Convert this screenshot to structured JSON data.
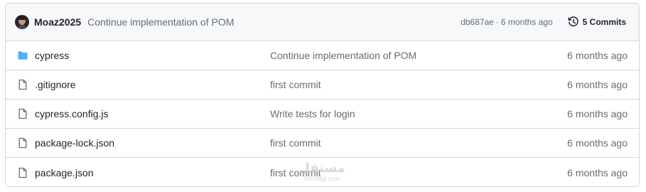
{
  "latest_commit": {
    "author": "Moaz2025",
    "message": "Continue implementation of POM",
    "sha": "db687ae",
    "separator": "·",
    "time": "6 months ago",
    "commits_label": "5 Commits"
  },
  "files": [
    {
      "name": "cypress",
      "type": "folder",
      "icon": "folder-icon",
      "message": "Continue implementation of POM",
      "age": "6 months ago"
    },
    {
      "name": ".gitignore",
      "type": "file",
      "icon": "file-icon",
      "message": "first commit",
      "age": "6 months ago"
    },
    {
      "name": "cypress.config.js",
      "type": "file",
      "icon": "file-icon",
      "message": "Write tests for login",
      "age": "6 months ago"
    },
    {
      "name": "package-lock.json",
      "type": "file",
      "icon": "file-icon",
      "message": "first commit",
      "age": "6 months ago"
    },
    {
      "name": "package.json",
      "type": "file",
      "icon": "file-icon",
      "message": "first commit",
      "age": "6 months ago"
    }
  ],
  "watermark": {
    "main": "مستقل",
    "sub": "mostaql.com"
  },
  "colors": {
    "folder": "#54aeff",
    "file_icon": "#656d76",
    "border": "#d0d7de",
    "header_bg": "#f6f8fa",
    "text_primary": "#1f2328",
    "text_muted": "#656d76"
  }
}
